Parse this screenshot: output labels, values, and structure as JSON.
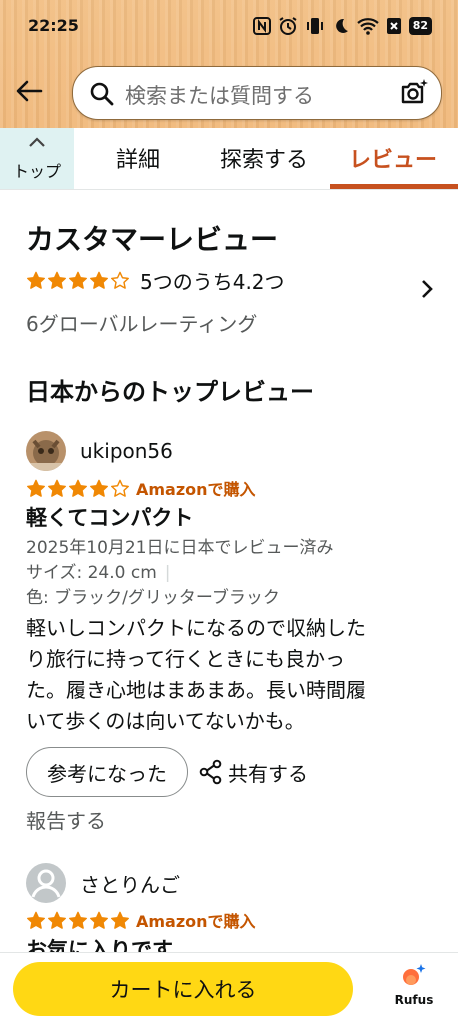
{
  "status": {
    "time": "22:25",
    "battery": "82",
    "icons": [
      "nfc-icon",
      "alarm-icon",
      "vibrate-icon",
      "moon-icon",
      "wifi-icon",
      "x-icon",
      "battery-icon"
    ]
  },
  "search": {
    "placeholder": "検索または質問する"
  },
  "tabs": {
    "top_label": "トップ",
    "items": [
      "詳細",
      "探索する",
      "レビュー"
    ],
    "active": "レビュー"
  },
  "summary": {
    "heading": "カスタマーレビュー",
    "stars": 4.2,
    "rating_text": "5つのうち4.2つ",
    "global_ratings": "6グローバルレーティング",
    "top_reviews_heading": "日本からのトップレビュー"
  },
  "reviews": [
    {
      "name": "ukipon56",
      "stars": 4,
      "verified": "Amazonで購入",
      "title": "軽くてコンパクト",
      "date": "2025年10月21日に日本でレビュー済み",
      "size": "サイズ: 24.0 cm",
      "color": "色: ブラック/グリッターブラック",
      "body_lines": [
        "軽いしコンパクトになるので収納した",
        "り旅行に持って行くときにも良かっ",
        "た。履き心地はまあまあ。長い時間履",
        "いて歩くのは向いてないかも。"
      ],
      "helpful_label": "参考になった",
      "share_label": "共有する",
      "report_label": "報告する"
    },
    {
      "name": "さとりんご",
      "stars": 5,
      "verified": "Amazonで購入",
      "title": "お気に入りです"
    }
  ],
  "bottom": {
    "cart_label": "カートに入れる",
    "rufus_label": "Rufus"
  },
  "colors": {
    "accent": "#c7511f",
    "star": "#f08804",
    "cart": "#ffd814",
    "verified": "#c45500"
  }
}
